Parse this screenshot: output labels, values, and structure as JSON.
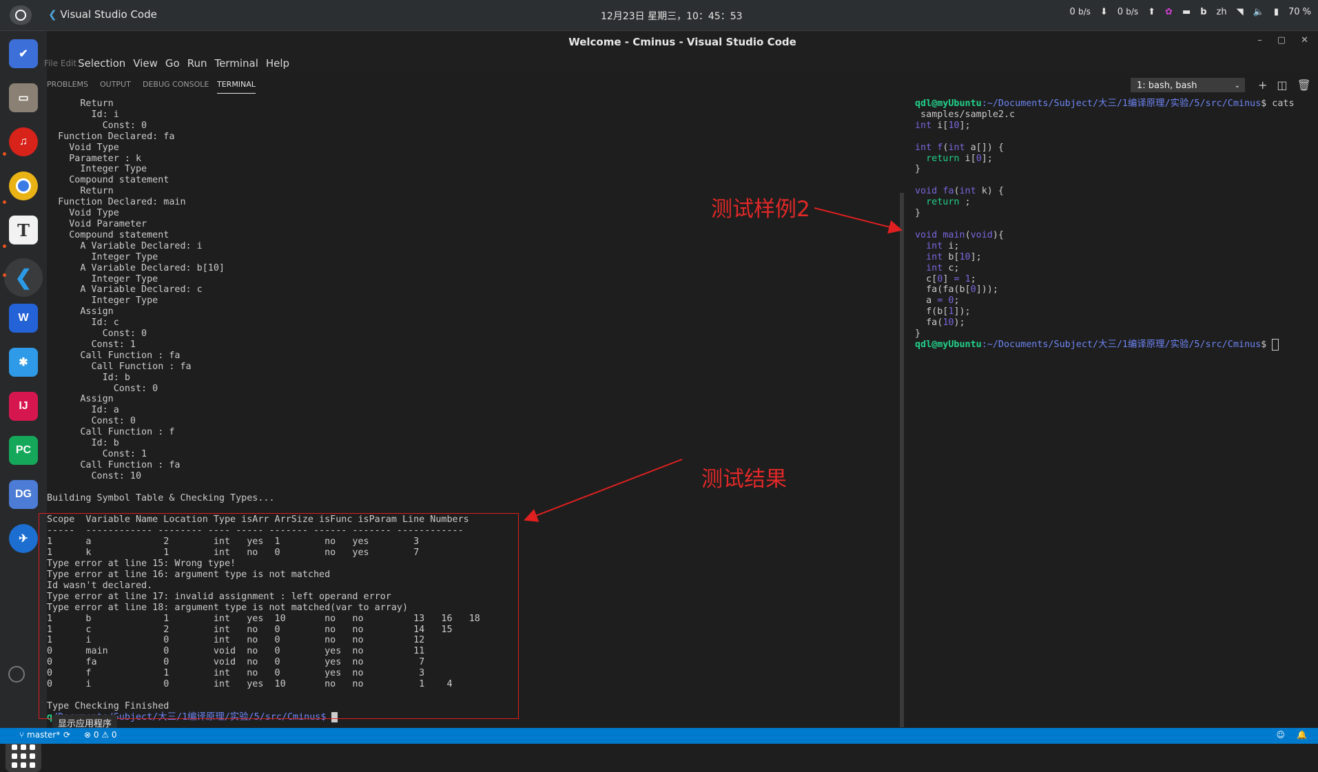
{
  "topbar": {
    "app_title": "Visual Studio Code",
    "datetime": "12月23日 星期三，10：45：53",
    "net_down": "0",
    "net_down_unit": "b/s",
    "net_up": "0",
    "net_up_unit": "b/s",
    "lang": "zh",
    "battery": "70 %"
  },
  "window": {
    "title": "Welcome - Cminus - Visual Studio Code"
  },
  "menu": {
    "file_edit": "File Edit",
    "selection": "Selection",
    "view": "View",
    "go": "Go",
    "run": "Run",
    "terminal": "Terminal",
    "help": "Help"
  },
  "panel": {
    "tabs": [
      "PROBLEMS",
      "OUTPUT",
      "DEBUG CONSOLE",
      "TERMINAL"
    ],
    "active_tab": "TERMINAL",
    "terminal_select": "1: bash, bash"
  },
  "left_terminal": {
    "ast_lines": [
      "      Return",
      "        Id: i",
      "          Const: 0",
      "  Function Declared: fa",
      "    Void Type",
      "    Parameter : k",
      "      Integer Type",
      "    Compound statement",
      "      Return",
      "  Function Declared: main",
      "    Void Type",
      "    Void Parameter",
      "    Compound statement",
      "      A Variable Declared: i",
      "        Integer Type",
      "      A Variable Declared: b[10]",
      "        Integer Type",
      "      A Variable Declared: c",
      "        Integer Type",
      "      Assign",
      "        Id: c",
      "          Const: 0",
      "        Const: 1",
      "      Call Function : fa",
      "        Call Function : fa",
      "          Id: b",
      "            Const: 0",
      "      Assign",
      "        Id: a",
      "        Const: 0",
      "      Call Function : f",
      "        Id: b",
      "          Const: 1",
      "      Call Function : fa",
      "        Const: 10",
      "",
      "Building Symbol Table & Checking Types...",
      ""
    ],
    "result_lines": [
      "Scope  Variable Name Location Type isArr ArrSize isFunc isParam Line Numbers",
      "-----  ------------ -------- ---- ----- ------- ------ ------- ------------",
      "1      a             2        int   yes  1        no   yes        3",
      "1      k             1        int   no   0        no   yes        7",
      "Type error at line 15: Wrong type!",
      "Type error at line 16: argument type is not matched",
      "Id wasn't declared.",
      "Type error at line 17: invalid assignment : left operand error",
      "Type error at line 18: argument type is not matched(var to array)",
      "1      b             1        int   yes  10       no   no         13   16   18",
      "1      c             2        int   no   0        no   no         14   15",
      "1      i             0        int   no   0        no   no         12",
      "0      main          0        void  no   0        yes  no         11",
      "0      fa            0        void  no   0        yes  no          7",
      "0      f             1        int   no   0        yes  no          3",
      "0      i             0        int   yes  10       no   no          1    4",
      "",
      "Type Checking Finished"
    ],
    "prompt_path": "/Documents/Subject/大三/1编译原理/实验/5/src/Cminus$"
  },
  "right_terminal": {
    "prompt_user": "qdl@myUbuntu",
    "prompt_path": ":~/Documents/Subject/大三/1编译原理/实验/5/src/Cminus",
    "command": "$ cats",
    "command_cont": " samples/sample2.c"
  },
  "annotations": {
    "sample_label": "测试样例2",
    "result_label": "测试结果"
  },
  "dock": {
    "tooltip": "显示应用程序"
  },
  "statusbar": {
    "branch": "master*",
    "problems": "⊗ 0 ⚠ 0"
  }
}
